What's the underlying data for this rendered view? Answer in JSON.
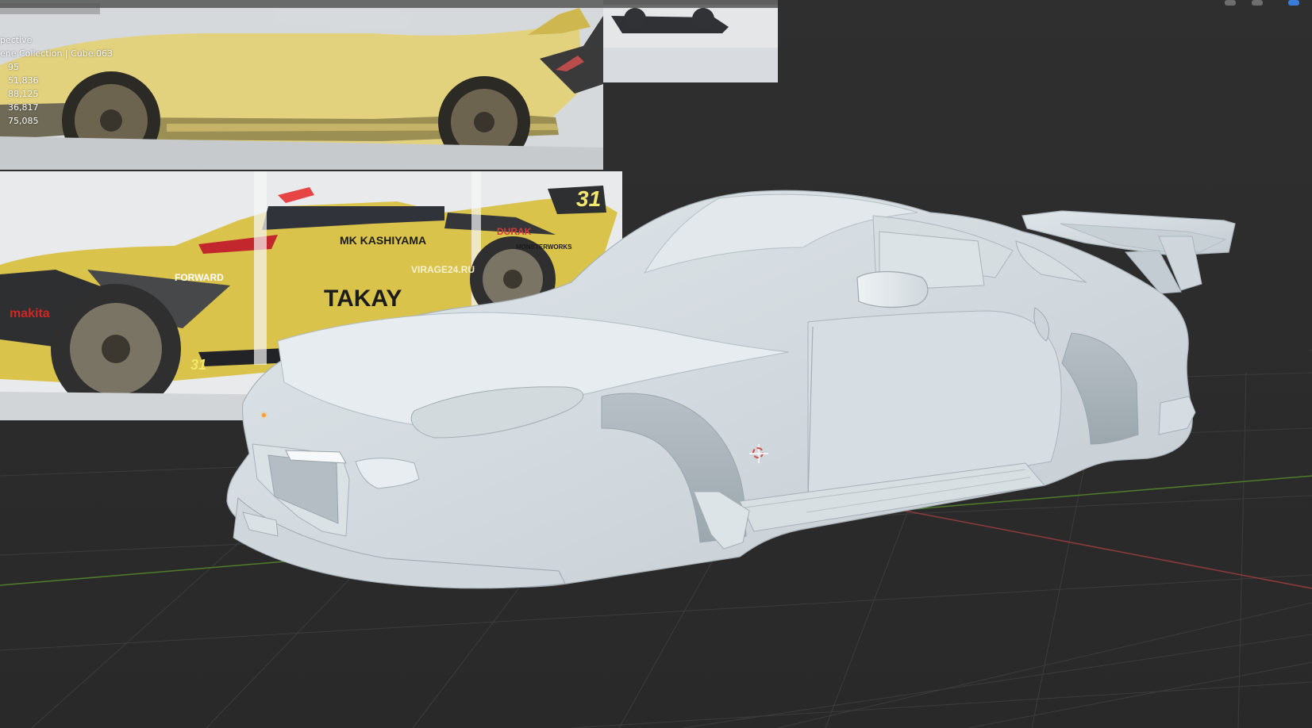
{
  "viewport": {
    "mode_label": "pective",
    "collection_label": "ene Collection | Cube.063",
    "stats": [
      "95",
      "51,836",
      "88,125",
      "36,817",
      "75,085"
    ]
  },
  "reference_images": {
    "bottom_text": {
      "number": "31",
      "sponsor_1": "MK KASHIYAMA",
      "sponsor_2": "VIRAGE24.RU",
      "sponsor_3": "TAKAY",
      "sponsor_4": "FORWARD",
      "sponsor_5": "makita",
      "sponsor_6": "DURAK",
      "sponsor_7": "MONSTERWORKS",
      "sponsor_8": "31"
    }
  },
  "colors": {
    "background": "#2b2b2b",
    "grid": "#3c3c3c",
    "x_axis": "#8e3b3b",
    "y_axis": "#4f7d29",
    "car_body": "#d9e0e5",
    "reference_yellow": "#e2d27e",
    "reference_gold": "#d9c34a",
    "cursor_ring": "#d44f4f",
    "origin_dot": "#ff9f32"
  }
}
